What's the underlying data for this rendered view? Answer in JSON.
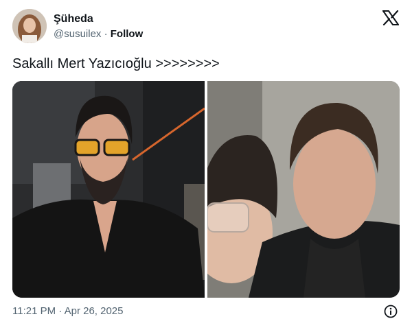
{
  "author": {
    "display_name": "Şüheda",
    "handle": "@susuilex",
    "separator": "·",
    "follow_label": "Follow"
  },
  "icons": {
    "platform": "x-logo-icon",
    "info": "info-icon"
  },
  "tweet": {
    "text": "Sakallı Mert Yazıcıoğlu >>>>>>>>",
    "timestamp": "11:21 PM · Apr 26, 2025"
  },
  "colors": {
    "text": "#0f1419",
    "secondary": "#536471",
    "background": "#ffffff"
  }
}
